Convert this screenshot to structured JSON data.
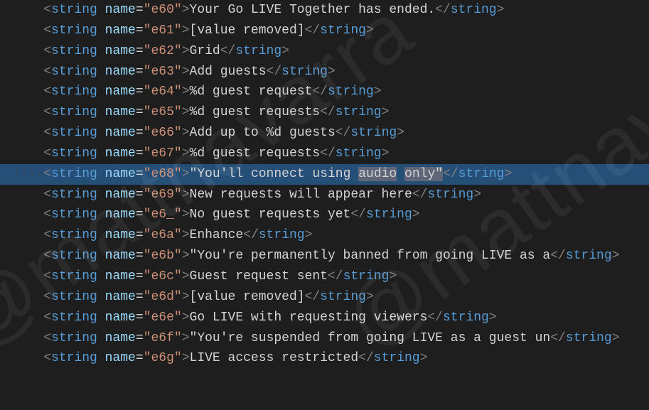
{
  "watermark": "@mattnavarra",
  "highlight_index": 8,
  "lines": [
    {
      "name": "e60",
      "value": "Your Go LIVE Together has ended."
    },
    {
      "name": "e61",
      "value": "[value removed]"
    },
    {
      "name": "e62",
      "value": "Grid"
    },
    {
      "name": "e63",
      "value": "Add guests"
    },
    {
      "name": "e64",
      "value": "%d guest request"
    },
    {
      "name": "e65",
      "value": "%d guest requests"
    },
    {
      "name": "e66",
      "value": "Add up to %d guests"
    },
    {
      "name": "e67",
      "value": "%d guest requests"
    },
    {
      "name": "e68",
      "value": "\"You'll connect using audio only\"",
      "highlight_words": [
        "audio",
        "only"
      ]
    },
    {
      "name": "e69",
      "value": "New requests will appear here"
    },
    {
      "name": "e6_",
      "value": "No guest requests yet"
    },
    {
      "name": "e6a",
      "value": "Enhance"
    },
    {
      "name": "e6b",
      "value": "\"You're permanently banned from going LIVE as a"
    },
    {
      "name": "e6c",
      "value": "Guest request sent"
    },
    {
      "name": "e6d",
      "value": "[value removed]"
    },
    {
      "name": "e6e",
      "value": "Go LIVE with requesting viewers"
    },
    {
      "name": "e6f",
      "value": "\"You're suspended from going LIVE as a guest un"
    },
    {
      "name": "e6g",
      "value": "LIVE access restricted"
    }
  ]
}
